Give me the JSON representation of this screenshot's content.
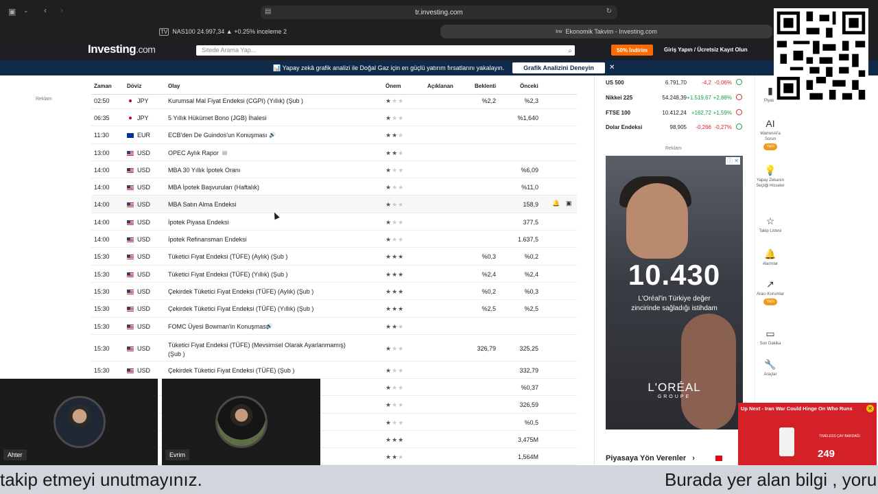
{
  "browser": {
    "url": "tr.investing.com",
    "tab_left": "NAS100 24.997,34 ▲ +0.25% inceleme 2",
    "tab_right": "Ekonomik Takvim - Investing.com"
  },
  "header": {
    "logo_main": "Investing",
    "logo_suffix": ".com",
    "search_placeholder": "Sitede Arama Yap...",
    "discount": "50% İndirim",
    "login": "Giriş Yapın  /  Ücretsiz Kayıt Olun"
  },
  "promo": {
    "text": "📊 Yapay zekâ grafik analizi ile Doğal Gaz için en güçlü yatırım fırsatlarını yakalayın.",
    "button": "Grafik Analizini Deneyin",
    "close": "✕"
  },
  "left_ad_label": "Reklam",
  "calendar": {
    "columns": [
      "Zaman",
      "Döviz",
      "Olay",
      "Önem",
      "Açıklanan",
      "Beklenti",
      "Önceki"
    ],
    "rows": [
      {
        "time": "02:50",
        "currency": "JPY",
        "flag": "jp",
        "event": "Kurumsal Mal Fiyat Endeksi (CGPI) (Yıllık) (Şub )",
        "stars": 1,
        "actual": "",
        "forecast": "%2,2",
        "previous": "%2,3",
        "icon": ""
      },
      {
        "time": "06:35",
        "currency": "JPY",
        "flag": "jp",
        "event": "5 Yıllık Hükümet Bono (JGB) İhalesi",
        "stars": 1,
        "actual": "",
        "forecast": "",
        "previous": "%1,640",
        "icon": ""
      },
      {
        "time": "11:30",
        "currency": "EUR",
        "flag": "eu",
        "event": "ECB'den De Guindos'un Konuşması",
        "stars": 2,
        "actual": "",
        "forecast": "",
        "previous": "",
        "icon": "🔊"
      },
      {
        "time": "13:00",
        "currency": "USD",
        "flag": "us",
        "event": "OPEC Aylık Rapor",
        "stars": 2,
        "actual": "",
        "forecast": "",
        "previous": "",
        "icon": "▤"
      },
      {
        "time": "14:00",
        "currency": "USD",
        "flag": "us",
        "event": "MBA 30 Yıllık İpotek Oranı",
        "stars": 1,
        "actual": "",
        "forecast": "",
        "previous": "%6,09",
        "icon": ""
      },
      {
        "time": "14:00",
        "currency": "USD",
        "flag": "us",
        "event": "MBA İpotek Başvuruları (Haftalık)",
        "stars": 1,
        "actual": "",
        "forecast": "",
        "previous": "%11,0",
        "icon": ""
      },
      {
        "time": "14:00",
        "currency": "USD",
        "flag": "us",
        "event": "MBA Satın Alma Endeksi",
        "stars": 1,
        "actual": "",
        "forecast": "",
        "previous": "158,9",
        "icon": ""
      },
      {
        "time": "14:00",
        "currency": "USD",
        "flag": "us",
        "event": "İpotek Piyasa Endeksi",
        "stars": 1,
        "actual": "",
        "forecast": "",
        "previous": "377,5",
        "icon": ""
      },
      {
        "time": "14:00",
        "currency": "USD",
        "flag": "us",
        "event": "İpotek Refinansman Endeksi",
        "stars": 1,
        "actual": "",
        "forecast": "",
        "previous": "1.637,5",
        "icon": ""
      },
      {
        "time": "15:30",
        "currency": "USD",
        "flag": "us",
        "event": "Tüketici Fiyat Endeksi (TÜFE) (Aylık) (Şub )",
        "stars": 3,
        "actual": "",
        "forecast": "%0,3",
        "previous": "%0,2",
        "icon": ""
      },
      {
        "time": "15:30",
        "currency": "USD",
        "flag": "us",
        "event": "Tüketici Fiyat Endeksi (TÜFE) (Yıllık) (Şub )",
        "stars": 3,
        "actual": "",
        "forecast": "%2,4",
        "previous": "%2,4",
        "icon": ""
      },
      {
        "time": "15:30",
        "currency": "USD",
        "flag": "us",
        "event": "Çekirdek Tüketici Fiyat Endeksi (TÜFE) (Aylık) (Şub )",
        "stars": 3,
        "actual": "",
        "forecast": "%0,2",
        "previous": "%0,3",
        "icon": ""
      },
      {
        "time": "15:30",
        "currency": "USD",
        "flag": "us",
        "event": "Çekirdek Tüketici Fiyat Endeksi (TÜFE) (Yıllık) (Şub )",
        "stars": 3,
        "actual": "",
        "forecast": "%2,5",
        "previous": "%2,5",
        "icon": ""
      },
      {
        "time": "15:30",
        "currency": "USD",
        "flag": "us",
        "event": "FOMC Üyesi Bowman'in Konuşması",
        "stars": 2,
        "actual": "",
        "forecast": "",
        "previous": "",
        "icon": "🔊"
      },
      {
        "time": "15:30",
        "currency": "USD",
        "flag": "us",
        "event": "Tüketici Fiyat Endeksi (TÜFE) (Mevsimsel Olarak Ayarlanmamış) (Şub )",
        "stars": 1,
        "actual": "",
        "forecast": "326,79",
        "previous": "325,25",
        "icon": ""
      },
      {
        "time": "15:30",
        "currency": "USD",
        "flag": "us",
        "event": "Çekirdek Tüketici Fiyat Endeksi (TÜFE) (Şub )",
        "stars": 1,
        "actual": "",
        "forecast": "",
        "previous": "332,79",
        "icon": ""
      },
      {
        "time": "",
        "currency": "",
        "flag": "",
        "event": ")",
        "stars": 1,
        "actual": "",
        "forecast": "",
        "previous": "%0,37",
        "icon": ""
      },
      {
        "time": "",
        "currency": "",
        "flag": "",
        "event": "",
        "stars": 1,
        "actual": "",
        "forecast": "",
        "previous": "326,59",
        "icon": ""
      },
      {
        "time": "",
        "currency": "",
        "flag": "",
        "event": "",
        "stars": 1,
        "actual": "",
        "forecast": "",
        "previous": "%0,5",
        "icon": ""
      },
      {
        "time": "",
        "currency": "",
        "flag": "",
        "event": "",
        "stars": 3,
        "actual": "",
        "forecast": "",
        "previous": "3,475M",
        "icon": ""
      },
      {
        "time": "",
        "currency": "",
        "flag": "",
        "event": "",
        "stars": 2,
        "actual": "",
        "forecast": "",
        "previous": "1,564M",
        "icon": ""
      }
    ]
  },
  "markets": [
    {
      "name": "US 500",
      "value": "6.791,70",
      "change": "-4,2",
      "pct": "-0,06%",
      "dir": "neg",
      "status": "pos"
    },
    {
      "name": "Nikkei 225",
      "value": "54.248,39",
      "change": "+1.519,67",
      "pct": "+2,88%",
      "dir": "pos",
      "status": "neg"
    },
    {
      "name": "FTSE 100",
      "value": "10.412,24",
      "change": "+162,72",
      "pct": "+1,59%",
      "dir": "pos",
      "status": "neg"
    },
    {
      "name": "Dolar Endeksi",
      "value": "98,905",
      "change": "-0,266",
      "pct": "-0,27%",
      "dir": "neg",
      "status": "pos"
    }
  ],
  "right_ad": {
    "label": "Reklam",
    "number": "10.430",
    "line1": "L'Oréal'in Türkiye değer",
    "line2": "zincirinde sağladığı istihdam",
    "brand": "L'ORÉAL",
    "brand_sub": "GROUPE",
    "info": "ⓘ ✕"
  },
  "leaders_title": "Piyasaya Yön Verenler",
  "sidebar": [
    {
      "icon": "▮",
      "label": "Piyasa"
    },
    {
      "icon": "AI",
      "label": "WarrenAI'a Sorun",
      "badge": "Yeni"
    },
    {
      "icon": "💡",
      "label": "Yapay Zekanın Seçtiği Hisseler"
    },
    {
      "icon": "☆",
      "label": "Takip Listesi"
    },
    {
      "icon": "🔔",
      "label": "Alarmlar"
    },
    {
      "icon": "↗",
      "label": "Aracı Kurumlar",
      "badge": "Yeni"
    },
    {
      "icon": "▭",
      "label": "Son Dakika"
    },
    {
      "icon": "🔧",
      "label": "Araçlar"
    }
  ],
  "upnext": {
    "title": "Up Next - Iran War Could Hinge On Who Runs",
    "close": "✕",
    "brand": "TIMELESS ÇAY BARDAĞI",
    "price": "249"
  },
  "cams": [
    {
      "name": "Ahter"
    },
    {
      "name": "Evrim"
    }
  ],
  "subtitle": {
    "left": "takip etmeyi unutmayınız.",
    "right": "Burada yer alan bilgi , yoru"
  },
  "colors": {
    "header_bg": "#1d1f22",
    "promo_bg": "#0f2a4a",
    "accent_orange": "#ff6a00",
    "positive": "#0d9e4a",
    "negative": "#d6232f"
  }
}
